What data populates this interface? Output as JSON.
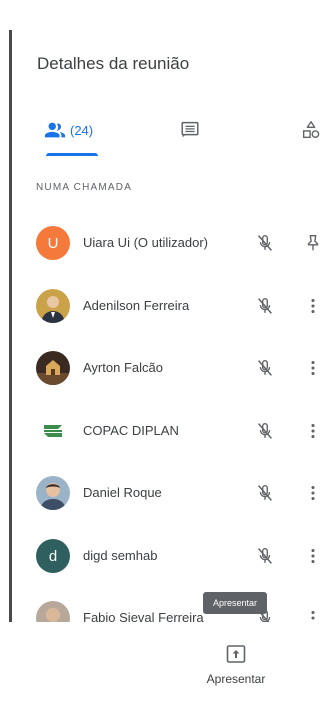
{
  "panel": {
    "title": "Detalhes da reunião",
    "tabs": [
      {
        "icon": "people-icon",
        "count": "(24)",
        "selected": true
      },
      {
        "icon": "chat-icon",
        "selected": false
      },
      {
        "icon": "activities-icon",
        "selected": false
      }
    ],
    "section_header": "NUMA CHAMADA",
    "participants": [
      {
        "name": "Uiara Ui (O utilizador)",
        "initial": "U",
        "avatar_color": "#f4793a",
        "mic": "muted",
        "action_icon": "pin-icon"
      },
      {
        "name": "Adenilson Ferreira",
        "avatar_icon": "photo-avatar",
        "mic": "muted",
        "action_icon": "more-vert-icon"
      },
      {
        "name": "Ayrton Falcão",
        "avatar_icon": "photo-avatar",
        "mic": "muted",
        "action_icon": "more-vert-icon"
      },
      {
        "name": "COPAC DIPLAN",
        "avatar_icon": "logo-avatar",
        "mic": "muted",
        "action_icon": "more-vert-icon"
      },
      {
        "name": "Daniel Roque",
        "avatar_icon": "photo-avatar",
        "mic": "muted",
        "action_icon": "more-vert-icon"
      },
      {
        "name": "digd semhab",
        "initial": "d",
        "avatar_color": "#2f5f5e",
        "mic": "muted",
        "action_icon": "more-vert-icon"
      },
      {
        "name": "Fabio Sieval Ferreira",
        "avatar_icon": "photo-avatar",
        "mic": "muted",
        "action_icon": "more-vert-icon"
      }
    ]
  },
  "bottom": {
    "tooltip": "Apresentar",
    "present_label": "Apresentar",
    "present_icon": "present-icon"
  },
  "colors": {
    "accent": "#1a73e8",
    "text": "#3c4043",
    "secondary_text": "#5f6368",
    "icon": "#5f6368"
  }
}
